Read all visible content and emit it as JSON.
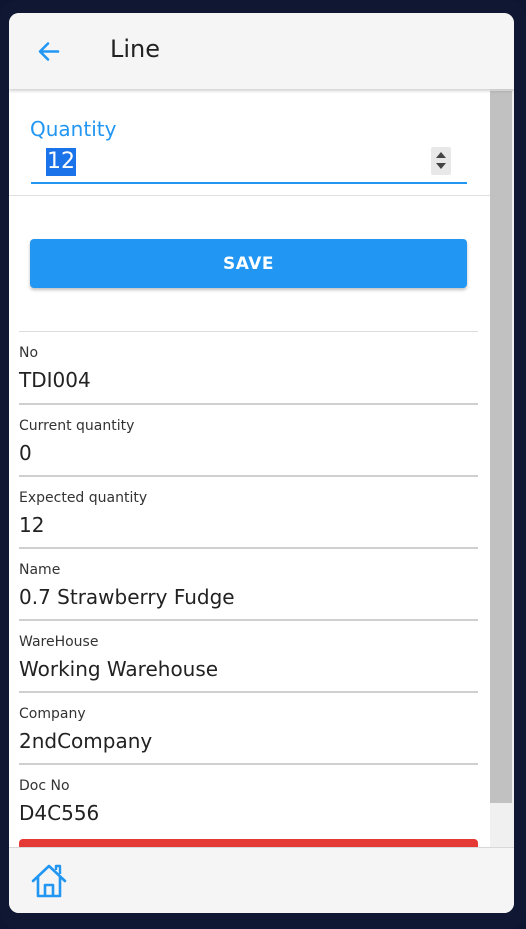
{
  "header": {
    "title": "Line",
    "back_icon": "arrow-left-icon"
  },
  "form": {
    "quantity_label": "Quantity",
    "quantity_value": "12",
    "save_label": "SAVE"
  },
  "details": [
    {
      "label": "No",
      "value": "TDI004"
    },
    {
      "label": "Current quantity",
      "value": "0"
    },
    {
      "label": "Expected quantity",
      "value": "12"
    },
    {
      "label": "Name",
      "value": "0.7 Strawberry Fudge"
    },
    {
      "label": "WareHouse",
      "value": "Working Warehouse"
    },
    {
      "label": "Company",
      "value": "2ndCompany"
    },
    {
      "label": "Doc No",
      "value": "D4C556"
    }
  ],
  "bottom_nav": {
    "home_icon": "home-icon"
  },
  "colors": {
    "accent": "#2196f3",
    "danger": "#e53935",
    "device_frame": "#0f1733"
  }
}
